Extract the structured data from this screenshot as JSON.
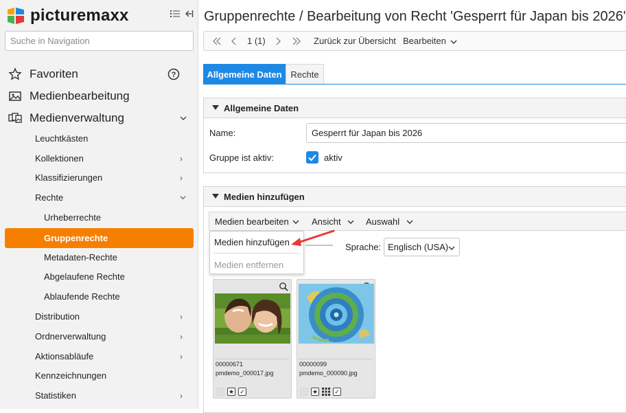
{
  "brand": {
    "name": "picturemaxx"
  },
  "nav": {
    "search_placeholder": "Suche in Navigation",
    "favorites": "Favoriten",
    "media_editing": "Medienbearbeitung",
    "media_management": "Medienverwaltung",
    "items": {
      "leuchtkaesten": "Leuchtkästen",
      "kollektionen": "Kollektionen",
      "klassifizierungen": "Klassifizierungen",
      "rechte": "Rechte",
      "urheberrechte": "Urheberrechte",
      "gruppenrechte": "Gruppenrechte",
      "metadaten_rechte": "Metadaten-Rechte",
      "abgelaufene_rechte": "Abgelaufene Rechte",
      "ablaufende_rechte": "Ablaufende Rechte",
      "distribution": "Distribution",
      "ordnerverwaltung": "Ordnerverwaltung",
      "aktionsablaeufe": "Aktionsabläufe",
      "kennzeichnungen": "Kennzeichnungen",
      "statistiken": "Statistiken"
    },
    "help_glyph": "?"
  },
  "page": {
    "title": "Gruppenrechte / Bearbeitung von Recht 'Gesperrt für Japan bis 2026'"
  },
  "toolbar": {
    "pager": "1 (1)",
    "back_label": "Zurück zur Übersicht",
    "edit_label": "Bearbeiten"
  },
  "tabs": {
    "general": "Allgemeine Daten",
    "rights": "Rechte"
  },
  "general_panel": {
    "title": "Allgemeine Daten",
    "name_label": "Name:",
    "name_value": "Gesperrt für Japan bis 2026",
    "active_label": "Gruppe ist aktiv:",
    "active_checkbox_label": "aktiv"
  },
  "media_panel": {
    "title": "Medien hinzufügen",
    "menu_edit": "Medien bearbeiten",
    "menu_view": "Ansicht",
    "menu_select": "Auswahl",
    "dropdown": {
      "add": "Medien hinzufügen",
      "remove": "Medien entfernen"
    },
    "language_label": "Sprache:",
    "language_value": "Englisch (USA)",
    "thumbnails": [
      {
        "id": "00000671",
        "filename": "pmdemo_000017.jpg"
      },
      {
        "id": "00000099",
        "filename": "pmdemo_000090.jpg"
      }
    ]
  },
  "colors": {
    "accent_orange": "#f77f00",
    "accent_blue": "#1e88e5",
    "arrow_red": "#e53935"
  }
}
